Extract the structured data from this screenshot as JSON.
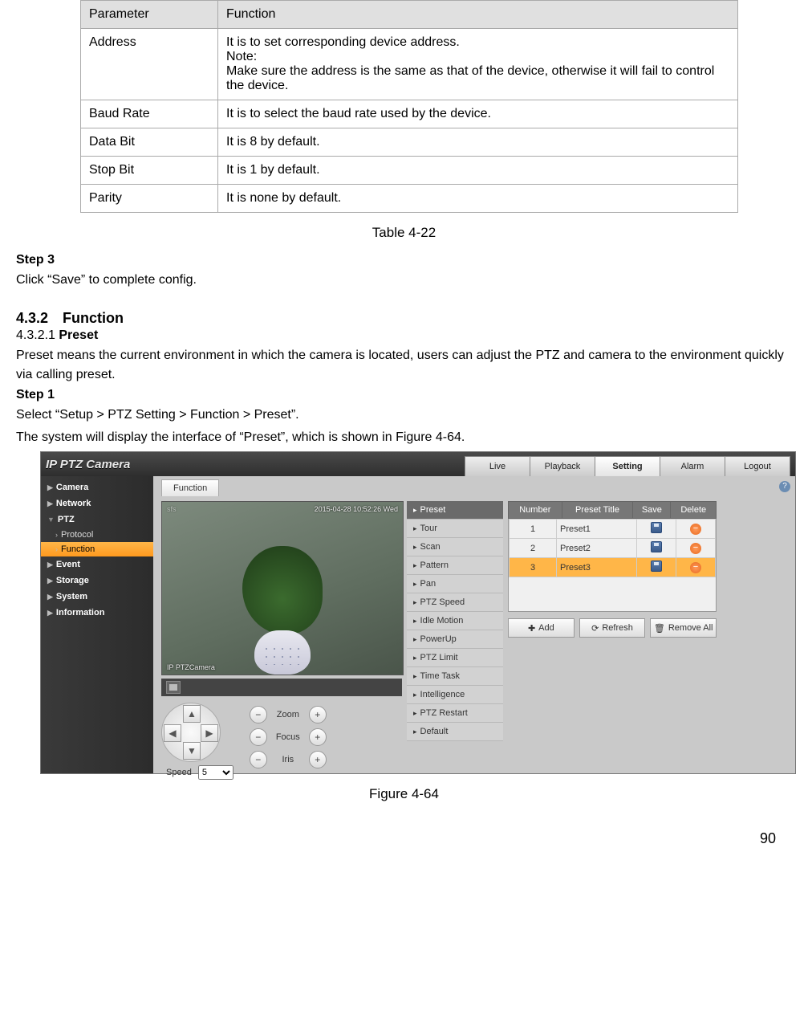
{
  "table": {
    "headers": {
      "param": "Parameter",
      "func": "Function"
    },
    "rows": [
      {
        "param": "Address",
        "func": "It is to set corresponding device address.\nNote:\nMake sure the address is the same as that of the device, otherwise it will fail to control the device."
      },
      {
        "param": "Baud Rate",
        "func": "It is to select the baud rate used by the device."
      },
      {
        "param": "Data Bit",
        "func": "It is 8 by default."
      },
      {
        "param": "Stop Bit",
        "func": "It is 1 by default."
      },
      {
        "param": "Parity",
        "func": "It is none by default."
      }
    ],
    "caption": "Table 4-22"
  },
  "text": {
    "step3_heading": "Step 3",
    "step3_body": "Click “Save” to complete config.",
    "sec_432": "4.3.2 Function",
    "sec_4321_num": "4.3.2.1 ",
    "sec_4321_title": "Preset",
    "preset_para": "Preset means the current environment in which the camera is located, users can adjust the PTZ and camera to the environment quickly via calling preset.",
    "step1_heading": "Step 1",
    "step1_body1": "Select “Setup > PTZ Setting > Function > Preset”.",
    "step1_body2": "The system will display the interface of “Preset”, which is shown in Figure 4-64.",
    "figure_caption": "Figure 4-64",
    "page_number": "90"
  },
  "shot": {
    "brand": "IP PTZ Camera",
    "topnav": [
      "Live",
      "Playback",
      "Setting",
      "Alarm",
      "Logout"
    ],
    "topnav_active": 2,
    "help": "?",
    "sidebar": [
      {
        "label": "Camera",
        "type": "top"
      },
      {
        "label": "Network",
        "type": "top"
      },
      {
        "label": "PTZ",
        "type": "top",
        "expanded": true,
        "children": [
          {
            "label": "Protocol",
            "selected": false
          },
          {
            "label": "Function",
            "selected": true
          }
        ]
      },
      {
        "label": "Event",
        "type": "top"
      },
      {
        "label": "Storage",
        "type": "top"
      },
      {
        "label": "System",
        "type": "top"
      },
      {
        "label": "Information",
        "type": "top"
      }
    ],
    "content_tab": "Function",
    "video": {
      "overlay_tl": "sfs",
      "overlay_tr": "2015-04-28 10:52:26 Wed",
      "overlay_bl": "IP PTZCamera"
    },
    "ptz": {
      "zoom_rows": [
        {
          "label": "Zoom"
        },
        {
          "label": "Focus"
        },
        {
          "label": "Iris"
        }
      ],
      "speed_label": "Speed",
      "speed_value": "5"
    },
    "func_list": [
      "Preset",
      "Tour",
      "Scan",
      "Pattern",
      "Pan",
      "PTZ Speed",
      "Idle Motion",
      "PowerUp",
      "PTZ Limit",
      "Time Task",
      "Intelligence",
      "PTZ Restart",
      "Default"
    ],
    "func_active": 0,
    "preset_headers": [
      "Number",
      "Preset Title",
      "Save",
      "Delete"
    ],
    "presets": [
      {
        "num": "1",
        "title": "Preset1"
      },
      {
        "num": "2",
        "title": "Preset2"
      },
      {
        "num": "3",
        "title": "Preset3",
        "selected": true
      }
    ],
    "buttons": {
      "add": "Add",
      "refresh": "Refresh",
      "remove": "Remove All"
    }
  }
}
